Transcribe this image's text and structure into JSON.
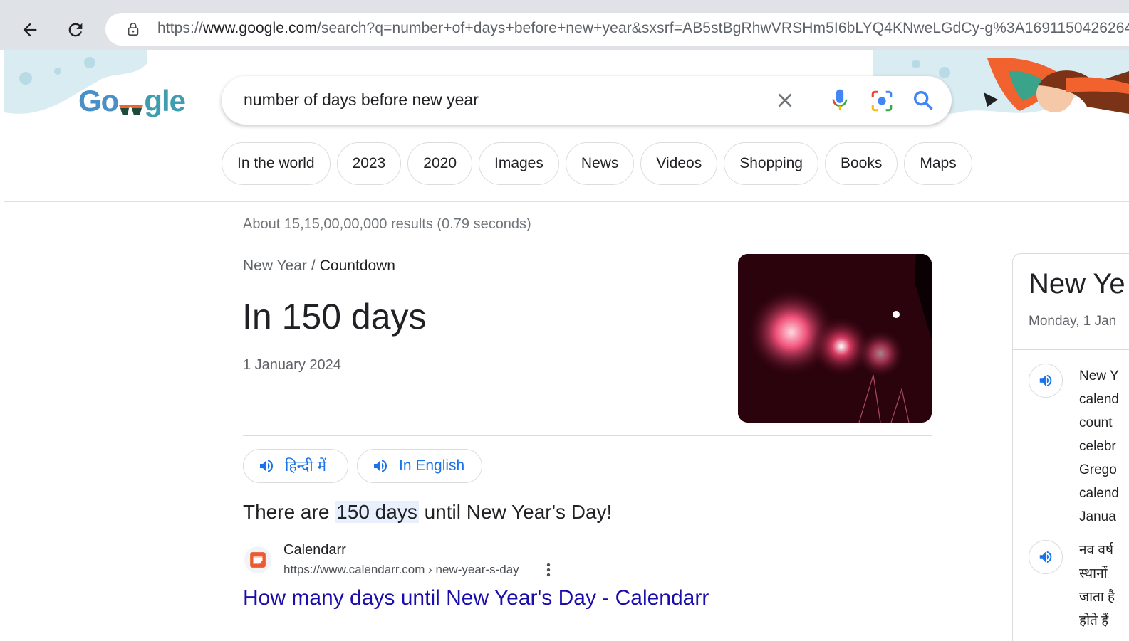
{
  "browser": {
    "url_prefix": "https://",
    "url_host": "www.google.com",
    "url_path": "/search?q=number+of+days+before+new+year&sxsrf=AB5stBgRhwVRSHm5I6bLYQ4KNweLGdCy-g%3A1691150426264&"
  },
  "search": {
    "logo_text_first": "Go",
    "logo_text_rest": "gle",
    "query": "number of days before new year"
  },
  "chips": [
    "In the world",
    "2023",
    "2020",
    "Images",
    "News",
    "Videos",
    "Shopping",
    "Books",
    "Maps"
  ],
  "results": {
    "stats": "About 15,15,00,00,000 results (0.79 seconds)"
  },
  "answer": {
    "breadcrumb_parent": "New Year",
    "breadcrumb_sep": "/",
    "breadcrumb_current": "Countdown",
    "headline": "In 150 days",
    "date": "1 January 2024",
    "lang_hindi": "हिन्दी में",
    "lang_english": "In English"
  },
  "snippet": {
    "before": "There are ",
    "highlight": "150 days",
    "after": " until New Year's Day!"
  },
  "source": {
    "name": "Calendarr",
    "url": "https://www.calendarr.com › new-year-s-day",
    "title": "How many days until New Year's Day - Calendarr"
  },
  "knowledge_panel": {
    "title": "New Ye",
    "subtitle": "Monday, 1 Jan",
    "english_lines": [
      "New Y",
      "calend",
      "count",
      "celebr",
      "Grego",
      "calend",
      "Janua"
    ],
    "hindi_lines": [
      "नव वर्ष",
      "स्थानों",
      "जाता है",
      "होते हैं"
    ]
  },
  "colors": {
    "link": "#1a0dab",
    "accent": "#1a73e8",
    "chrome": "#dfe3e8"
  }
}
